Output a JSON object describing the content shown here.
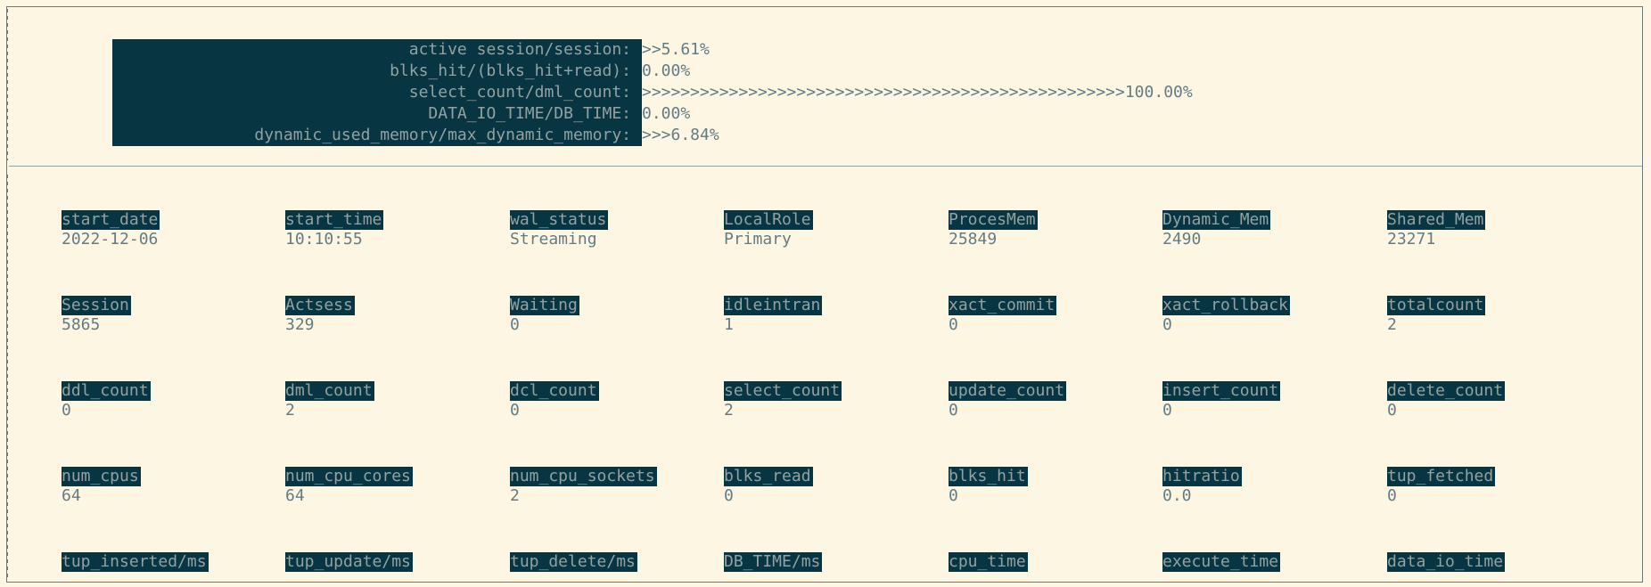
{
  "ratios": [
    {
      "label": "active session/session:",
      "value": ">>5.61%"
    },
    {
      "label": "blks_hit/(blks_hit+read):",
      "value": "0.00%"
    },
    {
      "label": "select_count/dml_count:",
      "value": ">>>>>>>>>>>>>>>>>>>>>>>>>>>>>>>>>>>>>>>>>>>>>>>>>>100.00%"
    },
    {
      "label": "DATA_IO_TIME/DB_TIME:",
      "value": "0.00%"
    },
    {
      "label": "dynamic_used_memory/max_dynamic_memory:",
      "value": ">>>6.84%"
    }
  ],
  "stats": [
    [
      {
        "header": "start_date",
        "value": "2022-12-06"
      },
      {
        "header": "start_time",
        "value": "10:10:55"
      },
      {
        "header": "wal_status",
        "value": "Streaming"
      },
      {
        "header": "LocalRole",
        "value": "Primary"
      },
      {
        "header": "ProcesMem",
        "value": "25849"
      },
      {
        "header": "Dynamic_Mem",
        "value": "2490"
      },
      {
        "header": "Shared_Mem",
        "value": "23271"
      }
    ],
    [
      {
        "header": "Session",
        "value": "5865"
      },
      {
        "header": "Actsess",
        "value": "329"
      },
      {
        "header": "Waiting",
        "value": "0"
      },
      {
        "header": "idleintran",
        "value": "1"
      },
      {
        "header": "xact_commit",
        "value": "0"
      },
      {
        "header": "xact_rollback",
        "value": "0"
      },
      {
        "header": "totalcount",
        "value": "2"
      }
    ],
    [
      {
        "header": "ddl_count",
        "value": "0"
      },
      {
        "header": "dml_count",
        "value": "2"
      },
      {
        "header": "dcl_count",
        "value": "0"
      },
      {
        "header": "select_count",
        "value": "2"
      },
      {
        "header": "update_count",
        "value": "0"
      },
      {
        "header": "insert_count",
        "value": "0"
      },
      {
        "header": "delete_count",
        "value": "0"
      }
    ],
    [
      {
        "header": "num_cpus",
        "value": "64"
      },
      {
        "header": "num_cpu_cores",
        "value": "64"
      },
      {
        "header": "num_cpu_sockets",
        "value": "2"
      },
      {
        "header": "blks_read",
        "value": "0"
      },
      {
        "header": "blks_hit",
        "value": "0"
      },
      {
        "header": "hitratio",
        "value": "0.0"
      },
      {
        "header": "tup_fetched",
        "value": "0"
      }
    ],
    [
      {
        "header": "tup_inserted/ms",
        "value": ""
      },
      {
        "header": "tup_update/ms",
        "value": ""
      },
      {
        "header": "tup_delete/ms",
        "value": ""
      },
      {
        "header": "DB_TIME/ms",
        "value": ""
      },
      {
        "header": "cpu_time",
        "value": ""
      },
      {
        "header": "execute_time",
        "value": ""
      },
      {
        "header": "data_io_time",
        "value": ""
      }
    ]
  ]
}
